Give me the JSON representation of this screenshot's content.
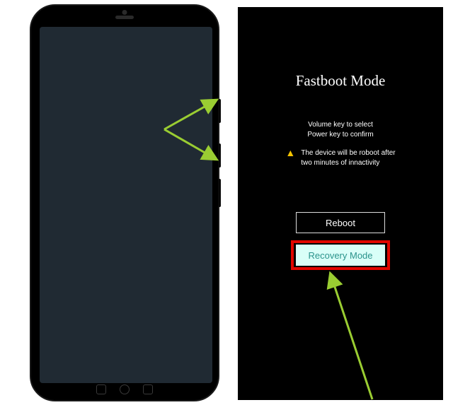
{
  "fastboot": {
    "title": "Fastboot Mode",
    "instruction_line1": "Volume key to select",
    "instruction_line2": "Power key to confirm",
    "warning_line1": "The device will be roboot after",
    "warning_line2": "two minutes of innactivity",
    "reboot_label": "Reboot",
    "recovery_label": "Recovery Mode"
  },
  "colors": {
    "highlight_border": "#e10600",
    "arrow": "#9acd32",
    "recovery_bg": "#d9fff8",
    "recovery_text": "#2b938c",
    "warn_icon": "#f5c400",
    "phone_screen": "#202a33"
  }
}
